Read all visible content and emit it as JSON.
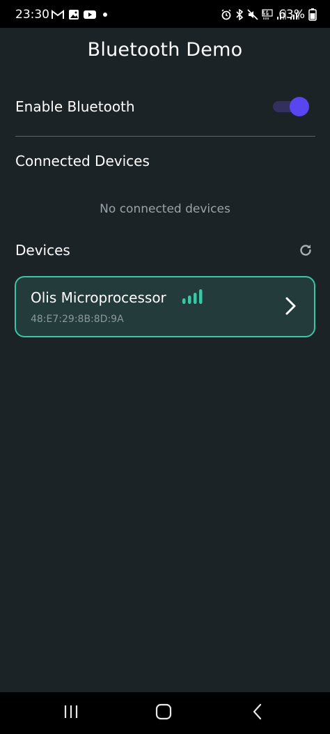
{
  "status_bar": {
    "time": "23:30",
    "battery_percent": "63%",
    "left_icons": [
      "gmail-icon",
      "gallery-icon",
      "youtube-icon",
      "notification-dot-icon"
    ],
    "right_icons": [
      "alarm-icon",
      "bluetooth-icon",
      "mute-icon",
      "5g-icon",
      "signal-icon",
      "signal-icon-2",
      "battery-icon"
    ]
  },
  "app": {
    "title": "Bluetooth Demo"
  },
  "settings": {
    "enable_label": "Enable Bluetooth",
    "bluetooth_enabled": true
  },
  "connected": {
    "title": "Connected Devices",
    "empty_text": "No connected devices"
  },
  "devices": {
    "title": "Devices",
    "items": [
      {
        "name": "Olis Microprocessor",
        "address": "48:E7:29:8B:8D:9A",
        "signal_bars": 4
      }
    ]
  },
  "colors": {
    "background": "#1b2327",
    "accent": "#5846f0",
    "card_border": "#3bc6a4",
    "signal": "#3bc6a4",
    "muted_text": "#98a4a8"
  }
}
